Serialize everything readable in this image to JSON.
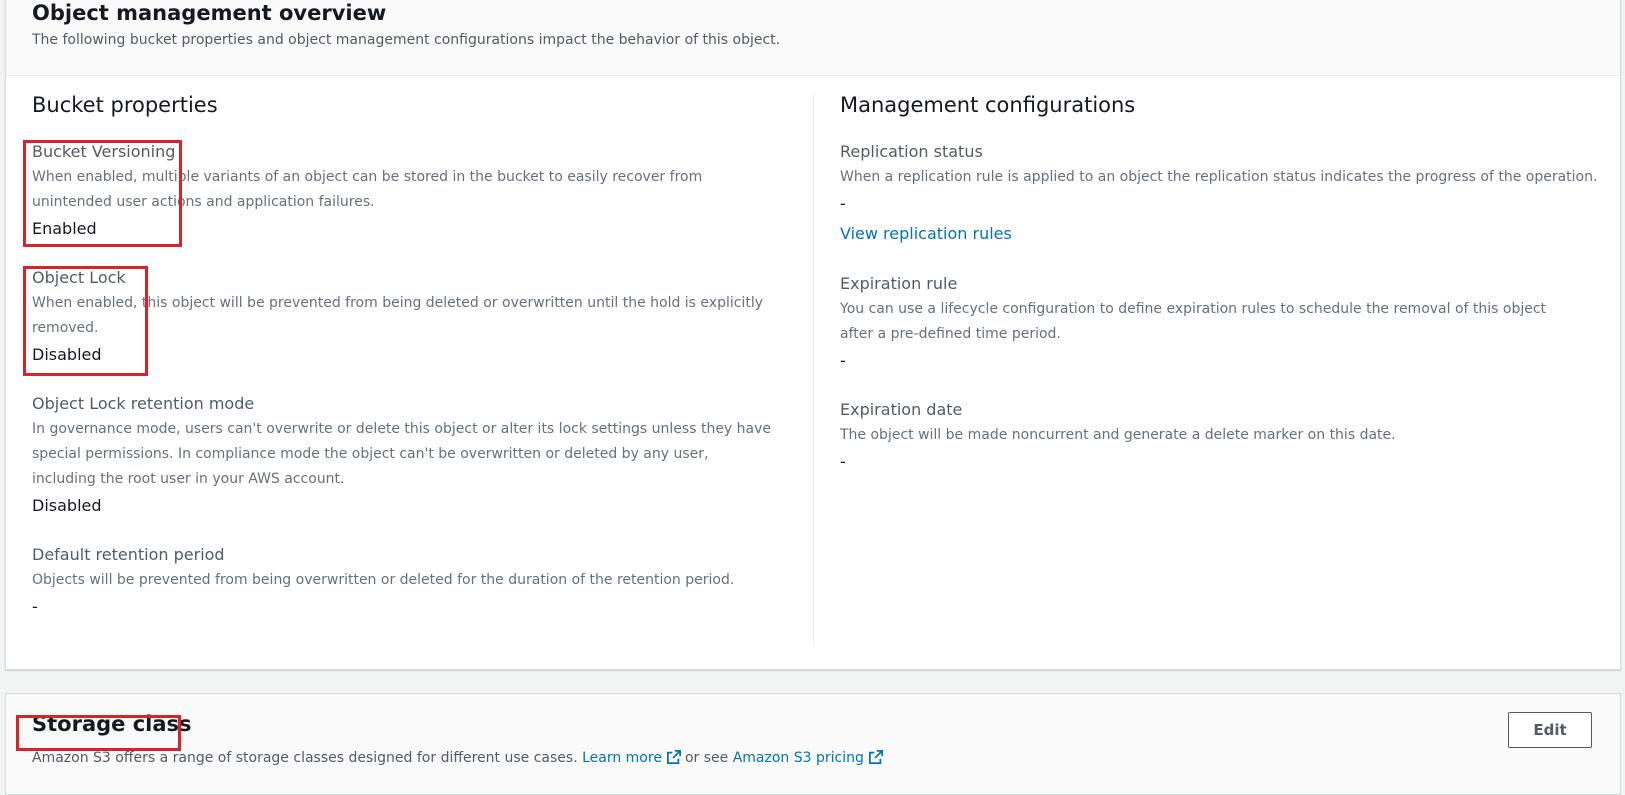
{
  "overview": {
    "title": "Object management overview",
    "description": "The following bucket properties and object management configurations impact the behavior of this object."
  },
  "bucket_properties": {
    "title": "Bucket properties",
    "items": [
      {
        "label": "Bucket Versioning",
        "description": "When enabled, multiple variants of an object can be stored in the bucket to easily recover from unintended user actions and application failures.",
        "value": "Enabled"
      },
      {
        "label": "Object Lock",
        "description": "When enabled, this object will be prevented from being deleted or overwritten until the hold is explicitly removed.",
        "value": "Disabled"
      },
      {
        "label": "Object Lock retention mode",
        "description": "In governance mode, users can't overwrite or delete this object or alter its lock settings unless they have special permissions. In compliance mode the object can't be overwritten or deleted by any user, including the root user in your AWS account.",
        "value": "Disabled"
      },
      {
        "label": "Default retention period",
        "description": "Objects will be prevented from being overwritten or deleted for the duration of the retention period.",
        "value": "-"
      }
    ]
  },
  "management_configurations": {
    "title": "Management configurations",
    "items": [
      {
        "label": "Replication status",
        "description": "When a replication rule is applied to an object the replication status indicates the progress of the operation.",
        "value": "-",
        "link": "View replication rules"
      },
      {
        "label": "Expiration rule",
        "description": "You can use a lifecycle configuration to define expiration rules to schedule the removal of this object after a pre-defined time period.",
        "value": "-"
      },
      {
        "label": "Expiration date",
        "description": "The object will be made noncurrent and generate a delete marker on this date.",
        "value": "-"
      }
    ]
  },
  "storage_class": {
    "title": "Storage class",
    "description": "Amazon S3 offers a range of storage classes designed for different use cases.",
    "learn_more": "Learn more",
    "or_see": "or see",
    "pricing_link": "Amazon S3 pricing",
    "edit_label": "Edit"
  },
  "colors": {
    "link": "#0073bb",
    "highlight": "#d6232c"
  },
  "icons": {
    "external_link": "external-link-icon"
  }
}
